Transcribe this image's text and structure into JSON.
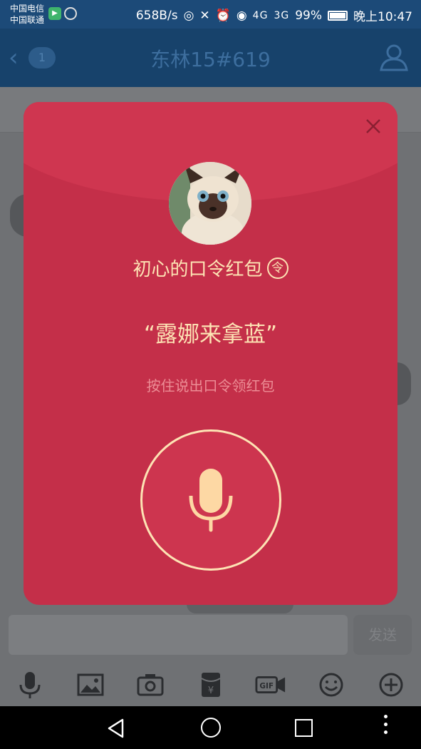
{
  "status_bar": {
    "carrier_1": "中国电信",
    "carrier_2": "中国联通",
    "speed": "658B/s",
    "net_1": "4G",
    "net_2": "3G",
    "battery": "99%",
    "time": "晚上10:47"
  },
  "header": {
    "unread_count": "1",
    "title": "东林15#619"
  },
  "red_packet": {
    "sender_title": "初心的口令红包",
    "badge": "令",
    "passphrase": "“露娜来拿蓝”",
    "hint": "按住说出口令领红包"
  },
  "input": {
    "send_label": "发送"
  },
  "toolbar": {
    "gif_label": "GIF"
  },
  "colors": {
    "envelope_red": "#c42f49",
    "gold": "#fde3b4",
    "hint_pink": "#ec8d95"
  }
}
